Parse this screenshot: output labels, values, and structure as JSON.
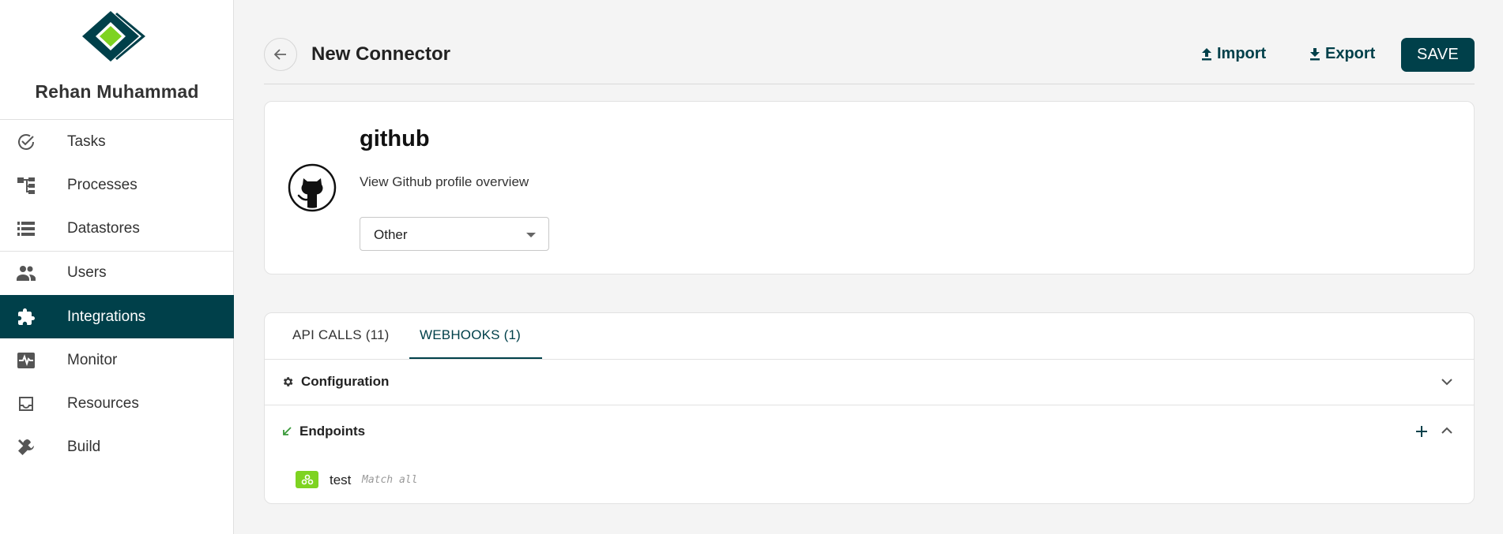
{
  "sidebar": {
    "user_name": "Rehan Muhammad",
    "items": [
      {
        "label": "Tasks",
        "icon": "check-circle-icon"
      },
      {
        "label": "Processes",
        "icon": "process-tree-icon"
      },
      {
        "label": "Datastores",
        "icon": "datastore-list-icon"
      },
      {
        "label": "Users",
        "icon": "users-icon"
      },
      {
        "label": "Integrations",
        "icon": "puzzle-icon",
        "active": true
      },
      {
        "label": "Monitor",
        "icon": "monitor-pulse-icon"
      },
      {
        "label": "Resources",
        "icon": "inbox-icon"
      },
      {
        "label": "Build",
        "icon": "tools-icon"
      }
    ]
  },
  "header": {
    "title": "New Connector",
    "import_label": "Import",
    "export_label": "Export",
    "save_label": "SAVE"
  },
  "connector": {
    "name": "github",
    "description": "View Github profile overview",
    "category": "Other",
    "icon": "github-icon"
  },
  "tabs": [
    {
      "label": "API CALLS (11)",
      "active": false
    },
    {
      "label": "WEBHOOKS (1)",
      "active": true
    }
  ],
  "sections": {
    "configuration": {
      "title": "Configuration",
      "icon": "gear-icon",
      "expanded": false
    },
    "endpoints": {
      "title": "Endpoints",
      "icon": "arrow-down-left-icon",
      "expanded": true,
      "items": [
        {
          "name": "test",
          "match": "Match all",
          "icon": "webhook-icon"
        }
      ]
    }
  },
  "colors": {
    "primary": "#00404a",
    "accent_green": "#7ed321",
    "background": "#f4f4f4"
  }
}
